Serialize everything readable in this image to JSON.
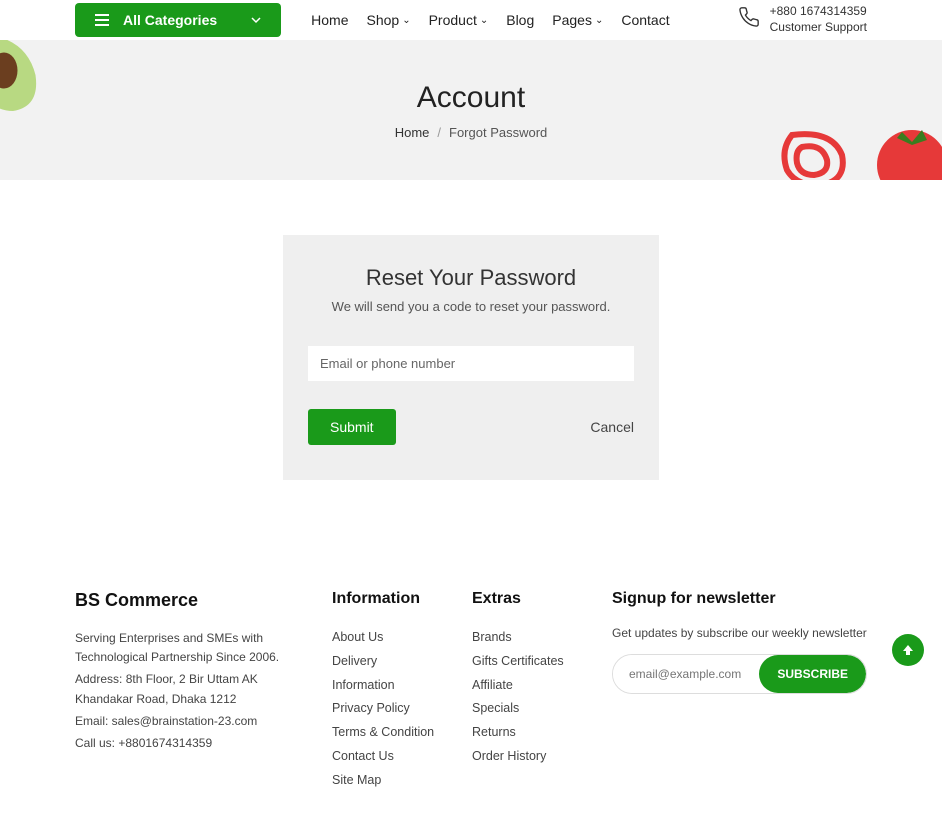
{
  "nav": {
    "categories_label": "All Categories",
    "items": [
      "Home",
      "Shop",
      "Product",
      "Blog",
      "Pages",
      "Contact"
    ],
    "support_phone": "+880 1674314359",
    "support_label": "Customer Support"
  },
  "banner": {
    "title": "Account",
    "crumb_home": "Home",
    "crumb_sep": "/",
    "crumb_current": "Forgot Password"
  },
  "reset": {
    "title": "Reset Your Password",
    "subtitle": "We will send you a code to reset your password.",
    "placeholder": "Email or phone number",
    "submit": "Submit",
    "cancel": "Cancel"
  },
  "footer": {
    "brand": {
      "title": "BS Commerce",
      "desc": "Serving Enterprises and SMEs with Technological Partnership Since 2006.",
      "address": "Address: 8th Floor, 2 Bir Uttam AK Khandakar Road, Dhaka 1212",
      "email": "Email: sales@brainstation-23.com",
      "phone": "Call us: +8801674314359"
    },
    "information": {
      "title": "Information",
      "items": [
        "About Us",
        "Delivery Information",
        "Privacy Policy",
        "Terms & Condition",
        "Contact Us",
        "Site Map"
      ]
    },
    "extras": {
      "title": "Extras",
      "items": [
        "Brands",
        "Gifts Certificates",
        "Affiliate",
        "Specials",
        "Returns",
        "Order History"
      ]
    },
    "newsletter": {
      "title": "Signup for newsletter",
      "desc": "Get updates by subscribe our weekly newsletter",
      "placeholder": "email@example.com",
      "button": "SUBSCRIBE"
    }
  }
}
